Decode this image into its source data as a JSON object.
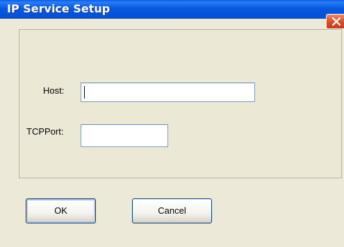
{
  "window": {
    "title": "IP Service Setup",
    "close_icon": "close-icon"
  },
  "form": {
    "host_label": "Host:",
    "host_value": "",
    "tcpport_label": "TCPPort:",
    "tcpport_value": ""
  },
  "buttons": {
    "ok_label": "OK",
    "cancel_label": "Cancel"
  },
  "colors": {
    "titlebar": "#0859e0",
    "face": "#ece9d8",
    "close": "#d9512c"
  }
}
